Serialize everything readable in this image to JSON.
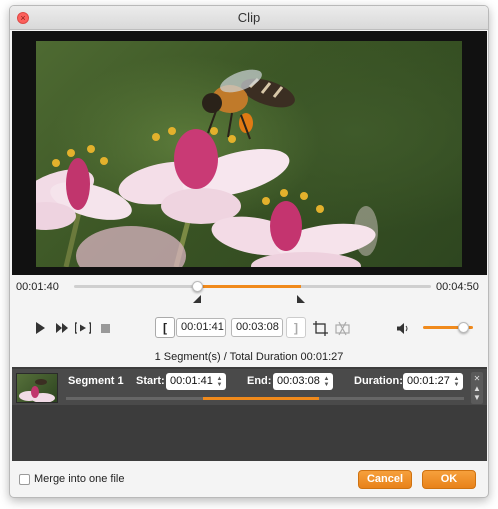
{
  "window": {
    "title": "Clip"
  },
  "player": {
    "current_time": "00:01:40",
    "total_time": "00:04:50",
    "range_start_fraction": 0.3448,
    "range_end_fraction": 0.6368,
    "volume_fraction": 0.85
  },
  "controls": {
    "start_time": "00:01:41",
    "end_time": "00:03:08",
    "set_start_label": "[",
    "set_end_label": "]"
  },
  "summary": {
    "text": "1 Segment(s) / Total Duration 00:01:27"
  },
  "segments": [
    {
      "name": "Segment 1",
      "start_label": "Start:",
      "start": "00:01:41",
      "end_label": "End:",
      "end": "00:03:08",
      "duration_label": "Duration:",
      "duration": "00:01:27"
    }
  ],
  "footer": {
    "merge_label": "Merge into one file",
    "merge_checked": false,
    "cancel_label": "Cancel",
    "ok_label": "OK"
  },
  "colors": {
    "accent": "#f08a1c",
    "segment_panel": "#3c3c3c"
  },
  "icons": [
    "close-icon",
    "play-icon",
    "fast-forward-icon",
    "play-segment-icon",
    "stop-icon",
    "crop-icon",
    "split-icon",
    "volume-icon",
    "chevron-up-icon",
    "chevron-down-icon"
  ]
}
